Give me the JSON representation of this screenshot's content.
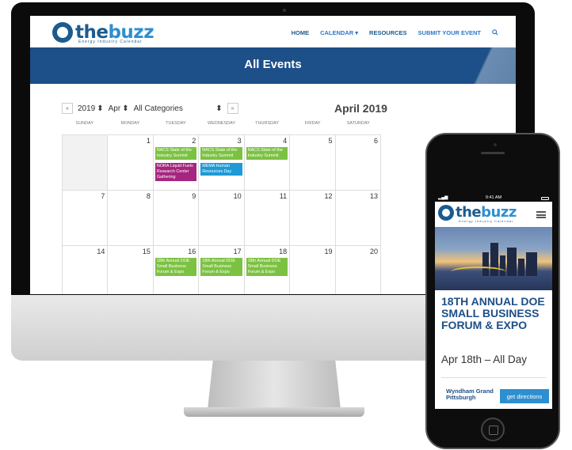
{
  "site": {
    "logo": {
      "the": "the",
      "buzz": "buzz",
      "tagline": "Energy Industry Calendar"
    },
    "nav": [
      "HOME",
      "CALENDAR ▾",
      "RESOURCES",
      "SUBMIT YOUR EVENT"
    ],
    "search_icon": "magnifier",
    "banner_title": "All Events"
  },
  "calendar": {
    "prev_label": "«",
    "next_label": "»",
    "year": "2019",
    "month": "Apr",
    "category": "All Categories",
    "month_title": "April 2019",
    "weekdays": [
      "SUNDAY",
      "MONDAY",
      "TUESDAY",
      "WEDNESDAY",
      "THURSDAY",
      "FRIDAY",
      "SATURDAY"
    ],
    "days": [
      "1",
      "2",
      "3",
      "4",
      "5",
      "6",
      "7",
      "8",
      "9",
      "10",
      "11",
      "12",
      "13",
      "14",
      "15",
      "16",
      "17",
      "18",
      "19",
      "20"
    ],
    "events": {
      "nacs": "NACS State of the Industry Summit",
      "nora": "NORA Liquid Fuels Research Center Gathering",
      "mema": "MEMA Human Resources Day",
      "doe": "18th Annual DOE Small Business Forum & Expo"
    }
  },
  "phone": {
    "status_time": "9:41 AM",
    "event_title": "18TH ANNUAL DOE SMALL BUSINESS FORUM & EXPO",
    "event_date": "Apr 18th – All Day",
    "venue": "Wyndham Grand Pittsburgh",
    "directions_label": "get directions"
  },
  "colors": {
    "brand_dark": "#1d4f88",
    "brand_light": "#2e8fd0",
    "green": "#7cc242",
    "purple": "#a4267e",
    "blue": "#1e9ad6"
  }
}
